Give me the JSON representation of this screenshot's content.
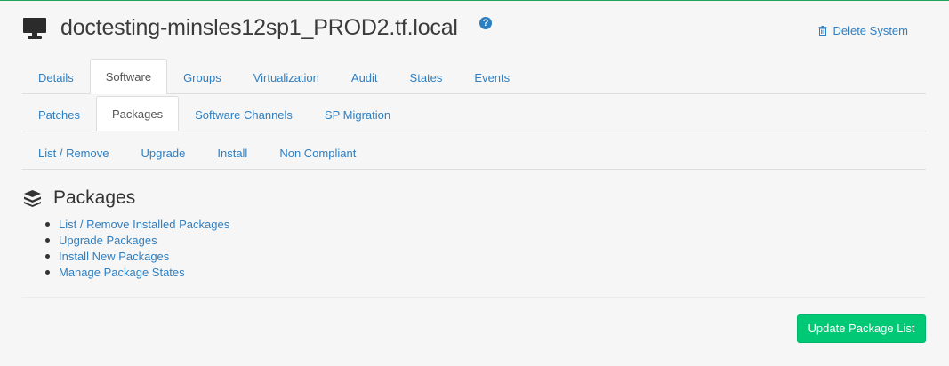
{
  "header": {
    "title": "doctesting-minsles12sp1_PROD2.tf.local",
    "help_glyph": "?",
    "delete_label": "Delete System"
  },
  "tabs_primary": [
    "Details",
    "Software",
    "Groups",
    "Virtualization",
    "Audit",
    "States",
    "Events"
  ],
  "tabs_secondary": [
    "Patches",
    "Packages",
    "Software Channels",
    "SP Migration"
  ],
  "tabs_tertiary": [
    "List / Remove",
    "Upgrade",
    "Install",
    "Non Compliant"
  ],
  "active": {
    "primary": "Software",
    "secondary": "Packages"
  },
  "section": {
    "title": "Packages",
    "links": [
      "List / Remove Installed Packages",
      "Upgrade Packages",
      "Install New Packages",
      "Manage Package States"
    ]
  },
  "actions": {
    "update_label": "Update Package List"
  },
  "colors": {
    "link": "#2f7fc1",
    "accent": "#00c875",
    "top_border": "#21a35a"
  }
}
